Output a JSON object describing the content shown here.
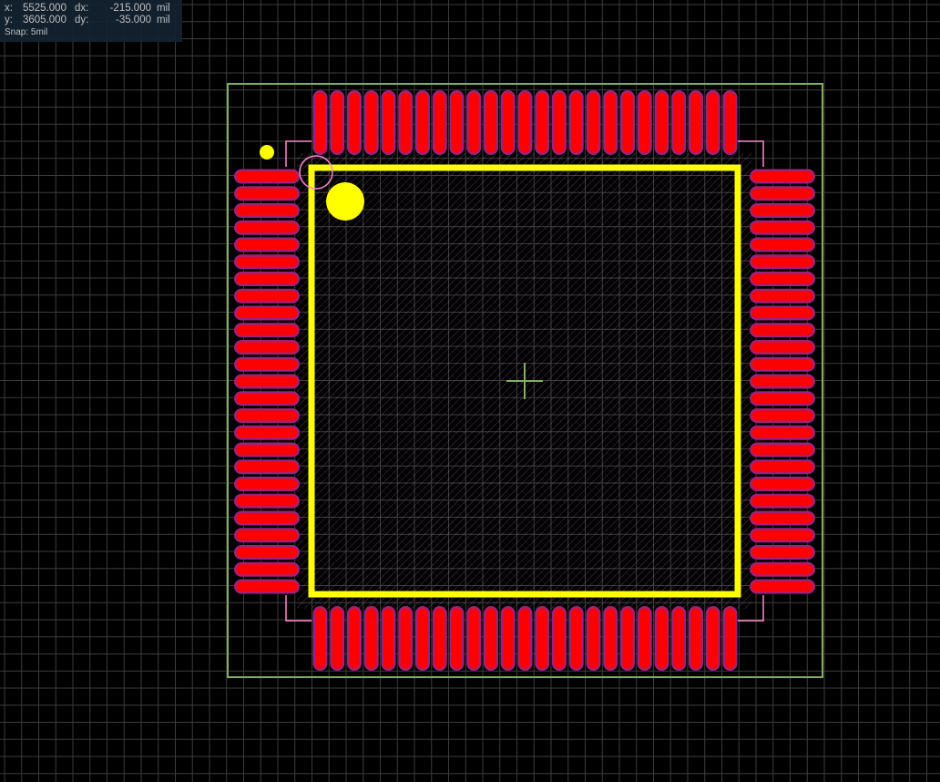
{
  "readout": {
    "x_label": "x:",
    "x_value": "5525.000",
    "dx_label": "dx:",
    "dx_value": "-215.000",
    "y_label": "y:",
    "y_value": "3605.000",
    "dy_label": "dy:",
    "dy_value": "-35.000",
    "unit": "mil",
    "snap": "Snap: 5mil"
  },
  "footprint": {
    "pads_per_side": 25,
    "colors": {
      "background": "#000000",
      "grid": "#3c3c3c",
      "pad_outer": "#a0217a",
      "pad_inner": "#ff0000",
      "silkscreen": "#ffff00",
      "courtyard": "#80b060",
      "fab_outline": "#ff88cc",
      "hatch": "#b07cb0"
    }
  }
}
